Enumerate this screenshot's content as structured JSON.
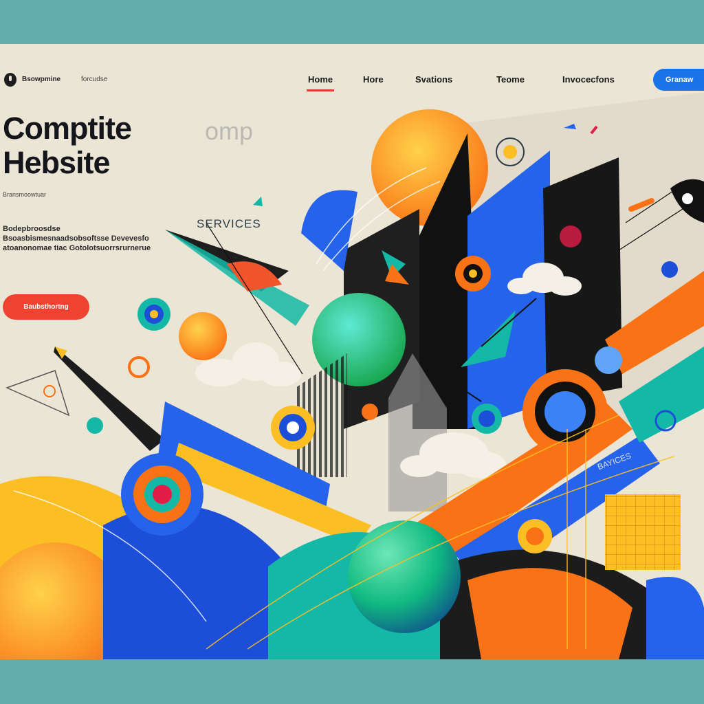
{
  "header": {
    "brand": "Bsowpmine",
    "brand_sub": "forcudse",
    "nav": [
      {
        "label": "Home"
      },
      {
        "label": "Hore"
      },
      {
        "label": "Svations"
      },
      {
        "label": "Teome"
      },
      {
        "label": "Invocecfons"
      }
    ],
    "cta": "Granaw"
  },
  "hero": {
    "title_line1": "Comptite",
    "title_line2": "Hebsite",
    "ghost": "omp",
    "tagline": "Bransmoowtuar",
    "paragraph": "Bodepbroosdse Bsoasbismesnaadsobsoftsse Devevesfo atoanonomae tiac Gotolotsuorrsrurnerue",
    "button": "Baubsthortng"
  },
  "art": {
    "services_label": "SERVICES",
    "services_label_2": "BAYICES"
  },
  "colors": {
    "background": "#ebe5d5",
    "accent": "#e83a2a",
    "blue": "#1a73e8",
    "orange": "#f7931e",
    "yellow": "#fbbf24",
    "teal": "#14b8a6"
  }
}
